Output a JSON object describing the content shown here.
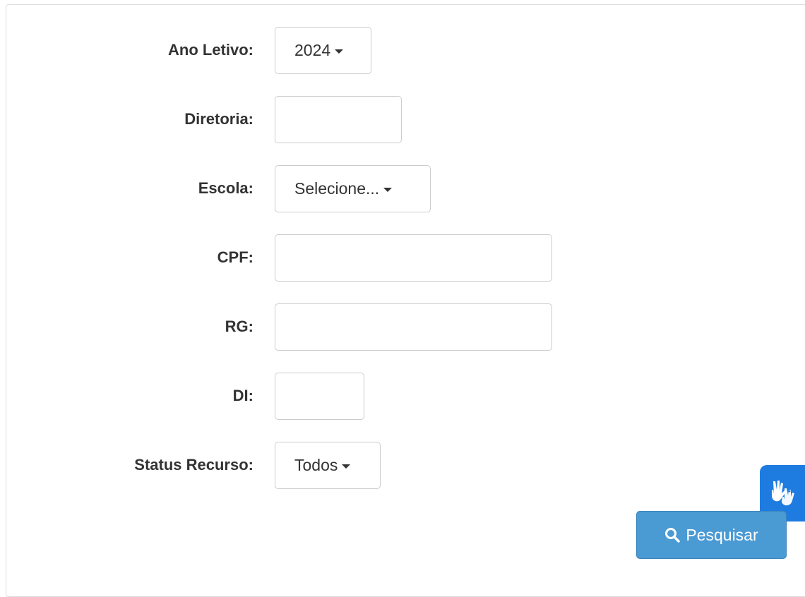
{
  "form": {
    "ano_letivo": {
      "label": "Ano Letivo:",
      "value": "2024"
    },
    "diretoria": {
      "label": "Diretoria:",
      "value": ""
    },
    "escola": {
      "label": "Escola:",
      "value": "Selecione..."
    },
    "cpf": {
      "label": "CPF:",
      "value": ""
    },
    "rg": {
      "label": "RG:",
      "value": ""
    },
    "di": {
      "label": "DI:",
      "value": ""
    },
    "status_recurso": {
      "label": "Status Recurso:",
      "value": "Todos"
    }
  },
  "actions": {
    "search_label": "Pesquisar",
    "search_icon": "search-icon"
  },
  "widgets": {
    "accessibility_icon": "sign-language-hands-icon"
  },
  "colors": {
    "primary_button": "#4a9ad4",
    "accessibility_widget": "#1e7be0"
  }
}
